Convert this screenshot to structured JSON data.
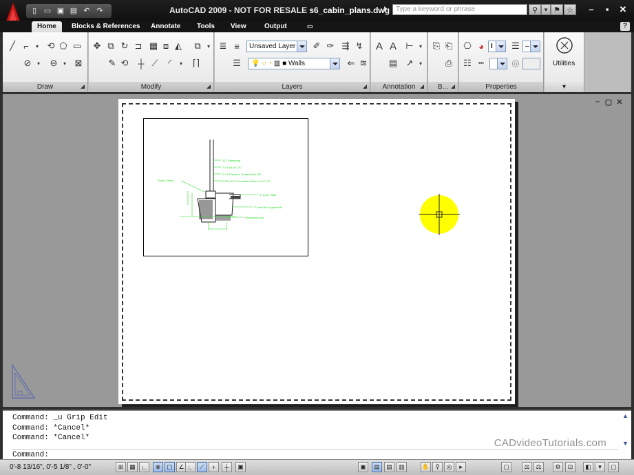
{
  "window": {
    "app_title": "AutoCAD 2009 - NOT FOR RESALE",
    "file_name": "s6_cabin_plans.dwg",
    "search_placeholder": "Type a keyword or phrase"
  },
  "ribbon": {
    "tabs": [
      "Home",
      "Blocks & References",
      "Annotate",
      "Tools",
      "View",
      "Output"
    ],
    "active_tab": "Home",
    "panels": {
      "draw": "Draw",
      "modify": "Modify",
      "layers": "Layers",
      "annotation": "Annotation",
      "block": "B...",
      "properties": "Properties",
      "utilities": "Utilities"
    },
    "layer_state": "Unsaved Layer",
    "current_layer": "Walls"
  },
  "drawing": {
    "detail_labels": [
      "1/2\" Sheathing",
      "2 x 6 @ 16\" OC",
      "2 x 6 Pressure Treated Mud Sill",
      "1/2\"Ø x 10\" Foundation Bolts at 4'-0\" OC",
      "Finish Grade",
      "4\" Conc. Slab",
      "2\" sand fill on gravel fill",
      "Undisturbed soil"
    ]
  },
  "command_line": {
    "history": [
      "Command: _u Grip Edit",
      "Command: *Cancel*",
      "Command: *Cancel*"
    ],
    "prompt": "Command:",
    "watermark": "CADvideoTutorials.com"
  },
  "status_bar": {
    "coordinates": "0'-8 13/16\", 0'-5 1/8\" , 0'-0\""
  },
  "colors": {
    "detail_green": "#22dd22",
    "highlight_yellow": "#ffff00",
    "canvas_gray": "#999999",
    "logo_red": "#cc1a1a"
  }
}
